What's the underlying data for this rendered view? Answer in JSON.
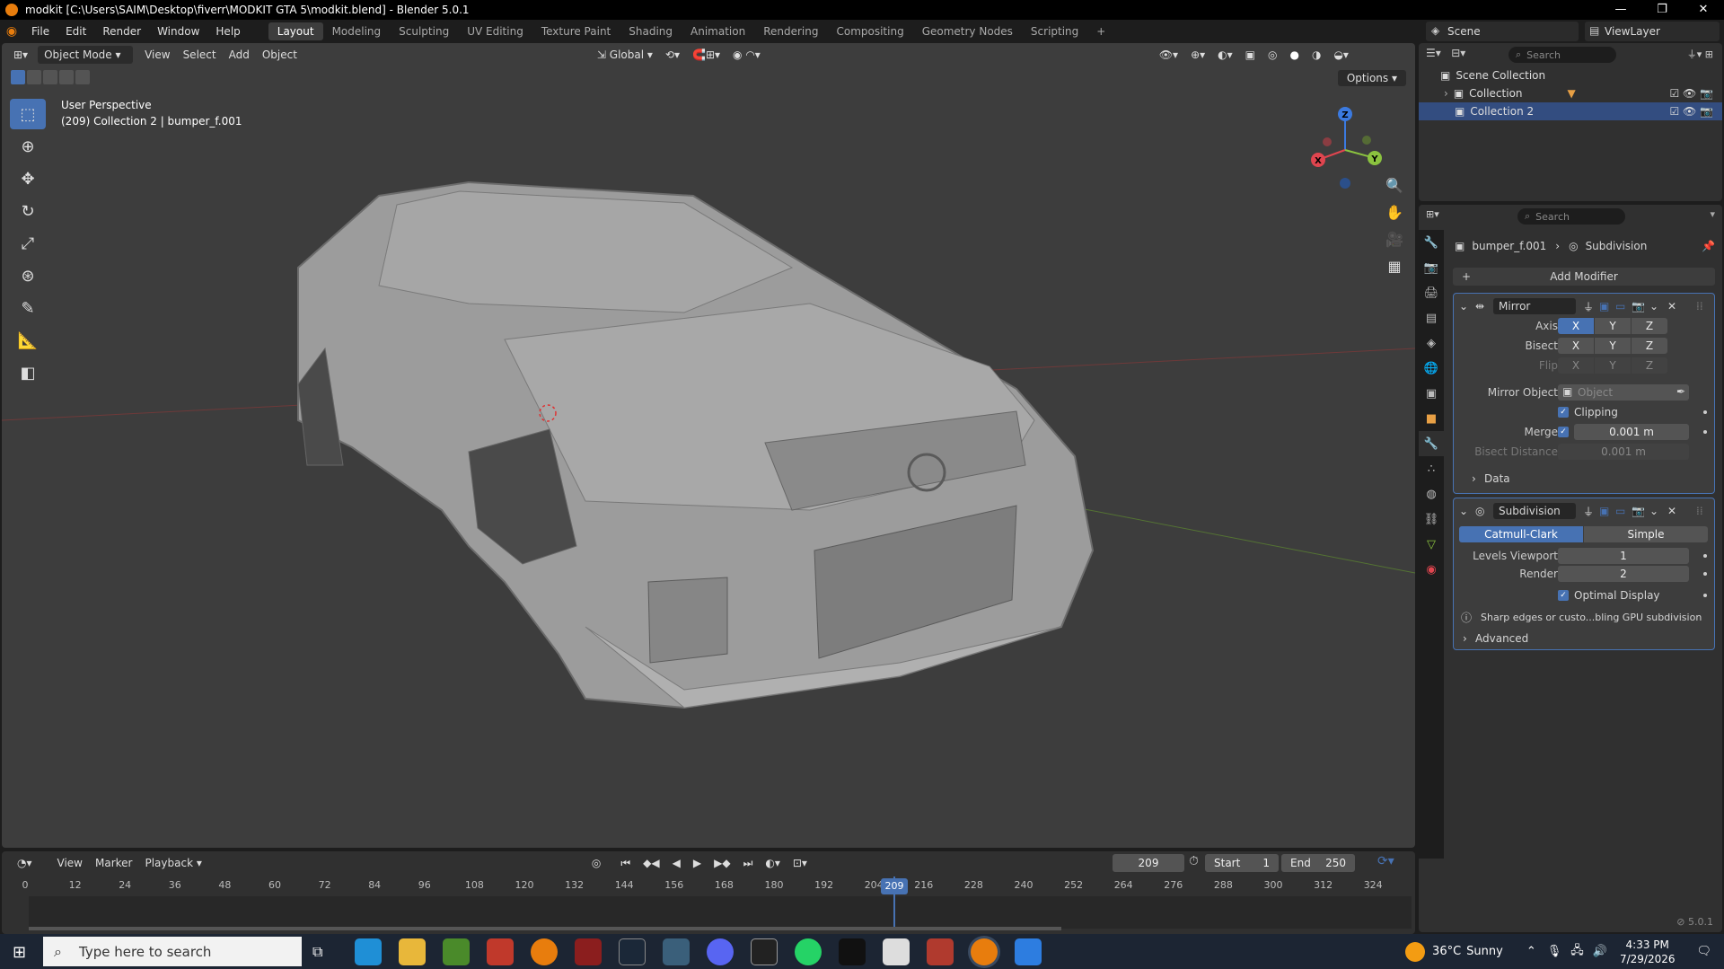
{
  "window": {
    "title": "modkit [C:\\Users\\SAIM\\Desktop\\fiverr\\MODKIT GTA 5\\modkit.blend] - Blender 5.0.1"
  },
  "menu": [
    "File",
    "Edit",
    "Render",
    "Window",
    "Help"
  ],
  "workspaces": [
    "Layout",
    "Modeling",
    "Sculpting",
    "UV Editing",
    "Texture Paint",
    "Shading",
    "Animation",
    "Rendering",
    "Compositing",
    "Geometry Nodes",
    "Scripting"
  ],
  "scene": {
    "name": "Scene",
    "view_layer": "ViewLayer"
  },
  "viewport": {
    "mode": "Object Mode",
    "menus": [
      "View",
      "Select",
      "Add",
      "Object"
    ],
    "orientation": "Global",
    "options_label": "Options",
    "info_line1": "User Perspective",
    "info_line2": "(209) Collection 2 | bumper_f.001",
    "gizmo": {
      "x": "X",
      "y": "Y",
      "z": "Z"
    },
    "toolbar_icons": [
      "select-box-icon",
      "cursor-icon",
      "move-icon",
      "rotate-icon",
      "scale-icon",
      "transform-icon",
      "annotate-icon",
      "measure-icon",
      "add-cube-icon"
    ]
  },
  "outliner": {
    "search_placeholder": "Search",
    "root": "Scene Collection",
    "items": [
      {
        "label": "Collection"
      },
      {
        "label": "Collection 2"
      }
    ]
  },
  "properties": {
    "search_placeholder": "Search",
    "object": "bumper_f.001",
    "modifier_context": "Subdivision",
    "add_modifier": "Add Modifier",
    "mirror": {
      "name": "Mirror",
      "axis_label": "Axis",
      "bisect_label": "Bisect",
      "flip_label": "Flip",
      "axes": [
        "X",
        "Y",
        "Z"
      ],
      "mirror_object_label": "Mirror Object",
      "mirror_object_placeholder": "Object",
      "clipping_label": "Clipping",
      "merge_label": "Merge",
      "merge_value": "0.001 m",
      "bisect_distance_label": "Bisect Distance",
      "bisect_distance_value": "0.001 m",
      "data_label": "Data"
    },
    "subdivision": {
      "name": "Subdivision",
      "mode_a": "Catmull-Clark",
      "mode_b": "Simple",
      "levels_viewport_label": "Levels Viewport",
      "levels_viewport": "1",
      "render_label": "Render",
      "render": "2",
      "optimal_display_label": "Optimal Display",
      "info": "Sharp edges or custo...bling GPU subdivision",
      "advanced_label": "Advanced"
    }
  },
  "timeline": {
    "menus": [
      "View",
      "Marker",
      "Playback"
    ],
    "current_frame": "209",
    "start_label": "Start",
    "start": "1",
    "end_label": "End",
    "end": "250",
    "ticks": [
      "0",
      "12",
      "24",
      "36",
      "48",
      "60",
      "72",
      "84",
      "96",
      "108",
      "120",
      "132",
      "144",
      "156",
      "168",
      "180",
      "192",
      "204",
      "216",
      "228",
      "240",
      "252",
      "264",
      "276",
      "288",
      "300",
      "312",
      "324"
    ],
    "playhead": "209"
  },
  "status": {
    "version": "5.0.1"
  },
  "taskbar": {
    "search_placeholder": "Type here to search",
    "weather_temp": "36°C",
    "weather_text": "Sunny",
    "time": "4:33 PM",
    "date": "7/29/2026"
  },
  "colors": {
    "accent": "#4772b3",
    "viewport_bg": "#3d3d3d",
    "panel_bg": "#303030",
    "header_bg": "#1d1d1d",
    "x_axis": "#e0454f",
    "y_axis": "#8bc33f",
    "z_axis": "#3b7ae0"
  }
}
